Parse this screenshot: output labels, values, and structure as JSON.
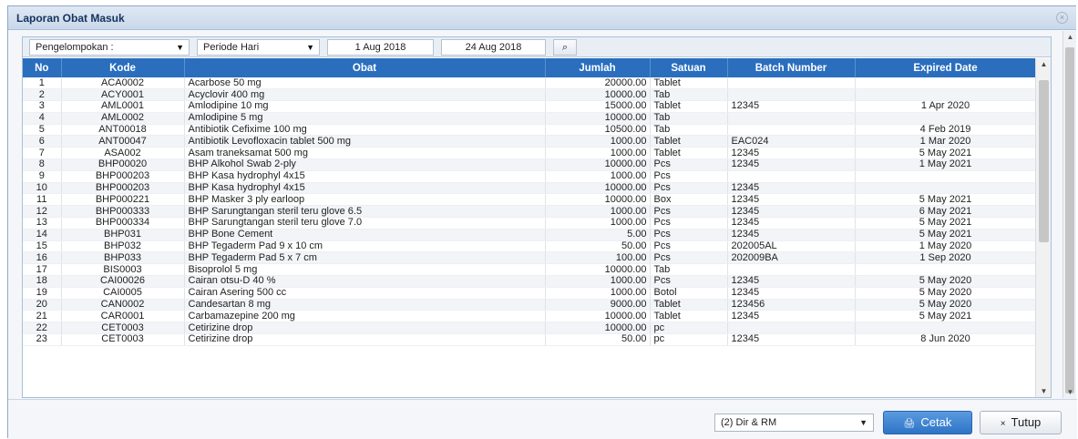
{
  "window": {
    "title": "Laporan Obat Masuk",
    "close_icon": "×"
  },
  "toolbar": {
    "grouping_label": "Pengelompokan :",
    "period_label": "Periode Hari",
    "date_from": "1 Aug 2018",
    "date_to": "24 Aug 2018",
    "search_icon": "⌕"
  },
  "table": {
    "columns": [
      "No",
      "Kode",
      "Obat",
      "Jumlah",
      "Satuan",
      "Batch Number",
      "Expired Date"
    ],
    "rows": [
      [
        "1",
        "ACA0002",
        "Acarbose 50 mg",
        "20000.00",
        "Tablet",
        "",
        ""
      ],
      [
        "2",
        "ACY0001",
        "Acyclovir 400 mg",
        "10000.00",
        "Tab",
        "",
        ""
      ],
      [
        "3",
        "AML0001",
        "Amlodipine 10 mg",
        "15000.00",
        "Tablet",
        "12345",
        "1 Apr 2020"
      ],
      [
        "4",
        "AML0002",
        "Amlodipine 5 mg",
        "10000.00",
        "Tab",
        "",
        ""
      ],
      [
        "5",
        "ANT00018",
        "Antibiotik Cefixime 100 mg",
        "10500.00",
        "Tab",
        "",
        "4 Feb 2019"
      ],
      [
        "6",
        "ANT00047",
        "Antibiotik Levofloxacin tablet 500 mg",
        "1000.00",
        "Tablet",
        "EAC024",
        "1 Mar 2020"
      ],
      [
        "7",
        "ASA002",
        "Asam traneksamat 500 mg",
        "1000.00",
        "Tablet",
        "12345",
        "5 May 2021"
      ],
      [
        "8",
        "BHP00020",
        "BHP Alkohol Swab 2-ply",
        "10000.00",
        "Pcs",
        "12345",
        "1 May 2021"
      ],
      [
        "9",
        "BHP000203",
        "BHP Kasa hydrophyl 4x15",
        "1000.00",
        "Pcs",
        "",
        ""
      ],
      [
        "10",
        "BHP000203",
        "BHP Kasa hydrophyl 4x15",
        "10000.00",
        "Pcs",
        "12345",
        ""
      ],
      [
        "11",
        "BHP000221",
        "BHP Masker 3 ply earloop",
        "10000.00",
        "Box",
        "12345",
        "5 May 2021"
      ],
      [
        "12",
        "BHP000333",
        "BHP Sarungtangan steril teru glove 6.5",
        "1000.00",
        "Pcs",
        "12345",
        "6 May 2021"
      ],
      [
        "13",
        "BHP000334",
        "BHP Sarungtangan steril teru glove 7.0",
        "1000.00",
        "Pcs",
        "12345",
        "5 May 2021"
      ],
      [
        "14",
        "BHP031",
        "BHP Bone Cement",
        "5.00",
        "Pcs",
        "12345",
        "5 May 2021"
      ],
      [
        "15",
        "BHP032",
        "BHP Tegaderm Pad 9 x 10 cm",
        "50.00",
        "Pcs",
        "202005AL",
        "1 May 2020"
      ],
      [
        "16",
        "BHP033",
        "BHP Tegaderm Pad 5 x 7 cm",
        "100.00",
        "Pcs",
        "202009BA",
        "1 Sep 2020"
      ],
      [
        "17",
        "BIS0003",
        "Bisoprolol 5 mg",
        "10000.00",
        "Tab",
        "",
        ""
      ],
      [
        "18",
        "CAI00026",
        "Cairan otsu-D 40 %",
        "1000.00",
        "Pcs",
        "12345",
        "5 May 2020"
      ],
      [
        "19",
        "CAI0005",
        "Cairan Asering 500 cc",
        "1000.00",
        "Botol",
        "12345",
        "5 May 2020"
      ],
      [
        "20",
        "CAN0002",
        "Candesartan 8 mg",
        "9000.00",
        "Tablet",
        "123456",
        "5 May 2020"
      ],
      [
        "21",
        "CAR0001",
        "Carbamazepine 200 mg",
        "10000.00",
        "Tablet",
        "12345",
        "5 May 2021"
      ],
      [
        "22",
        "CET0003",
        "Cetirizine drop",
        "10000.00",
        "pc",
        "",
        ""
      ],
      [
        "23",
        "CET0003",
        "Cetirizine drop",
        "50.00",
        "pc",
        "12345",
        "8 Jun 2020"
      ]
    ]
  },
  "footer": {
    "print_option": "(2) Dir & RM",
    "print_label": "Cetak",
    "print_icon": "🖨",
    "close_label": "Tutup",
    "close_icon": "×"
  }
}
